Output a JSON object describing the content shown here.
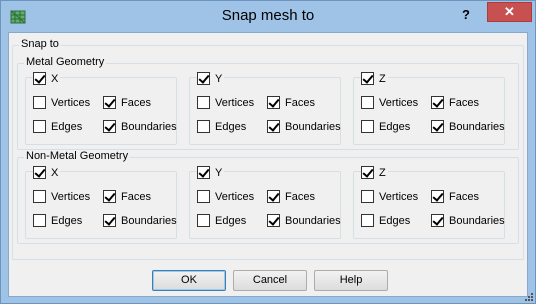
{
  "window": {
    "title": "Snap mesh to",
    "help_glyph": "?",
    "close_glyph": "✕",
    "icon": "mesh-app-icon"
  },
  "snap_to": {
    "legend": "Snap to",
    "groups": [
      {
        "legend": "Metal Geometry",
        "axes": [
          {
            "label": "X",
            "checked": true,
            "options": [
              {
                "label": "Vertices",
                "checked": false
              },
              {
                "label": "Faces",
                "checked": true
              },
              {
                "label": "Edges",
                "checked": false
              },
              {
                "label": "Boundaries",
                "checked": true
              }
            ]
          },
          {
            "label": "Y",
            "checked": true,
            "options": [
              {
                "label": "Vertices",
                "checked": false
              },
              {
                "label": "Faces",
                "checked": true
              },
              {
                "label": "Edges",
                "checked": false
              },
              {
                "label": "Boundaries",
                "checked": true
              }
            ]
          },
          {
            "label": "Z",
            "checked": true,
            "options": [
              {
                "label": "Vertices",
                "checked": false
              },
              {
                "label": "Faces",
                "checked": true
              },
              {
                "label": "Edges",
                "checked": false
              },
              {
                "label": "Boundaries",
                "checked": true
              }
            ]
          }
        ]
      },
      {
        "legend": "Non-Metal Geometry",
        "axes": [
          {
            "label": "X",
            "checked": true,
            "options": [
              {
                "label": "Vertices",
                "checked": false
              },
              {
                "label": "Faces",
                "checked": true
              },
              {
                "label": "Edges",
                "checked": false
              },
              {
                "label": "Boundaries",
                "checked": true
              }
            ]
          },
          {
            "label": "Y",
            "checked": true,
            "options": [
              {
                "label": "Vertices",
                "checked": false
              },
              {
                "label": "Faces",
                "checked": true
              },
              {
                "label": "Edges",
                "checked": false
              },
              {
                "label": "Boundaries",
                "checked": true
              }
            ]
          },
          {
            "label": "Z",
            "checked": true,
            "options": [
              {
                "label": "Vertices",
                "checked": false
              },
              {
                "label": "Faces",
                "checked": true
              },
              {
                "label": "Edges",
                "checked": false
              },
              {
                "label": "Boundaries",
                "checked": true
              }
            ]
          }
        ]
      }
    ]
  },
  "buttons": {
    "ok": "OK",
    "cancel": "Cancel",
    "help": "Help"
  }
}
